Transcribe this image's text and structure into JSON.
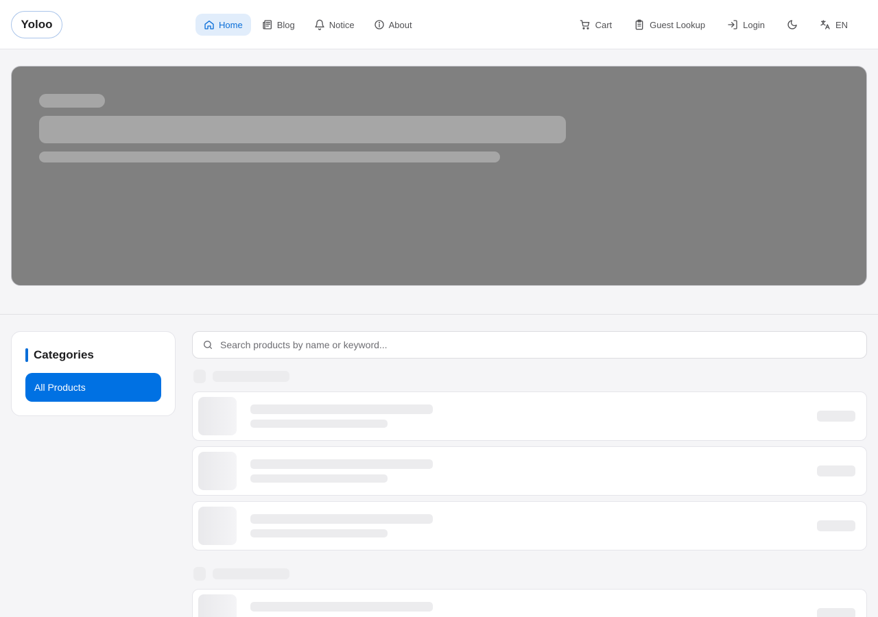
{
  "header": {
    "logo": "Yoloo",
    "nav": [
      {
        "label": "Home",
        "icon": "home-icon",
        "active": true
      },
      {
        "label": "Blog",
        "icon": "newspaper-icon",
        "active": false
      },
      {
        "label": "Notice",
        "icon": "bell-icon",
        "active": false
      },
      {
        "label": "About",
        "icon": "info-icon",
        "active": false
      }
    ],
    "actions": {
      "cart": "Cart",
      "guest_lookup": "Guest Lookup",
      "login": "Login",
      "language": "EN"
    }
  },
  "categories": {
    "title": "Categories",
    "items": [
      "All Products"
    ]
  },
  "search": {
    "placeholder": "Search products by name or keyword...",
    "value": ""
  },
  "colors": {
    "accent": "#0071e3",
    "active_nav_bg": "#e1edfb",
    "hero_bg": "#808080"
  }
}
